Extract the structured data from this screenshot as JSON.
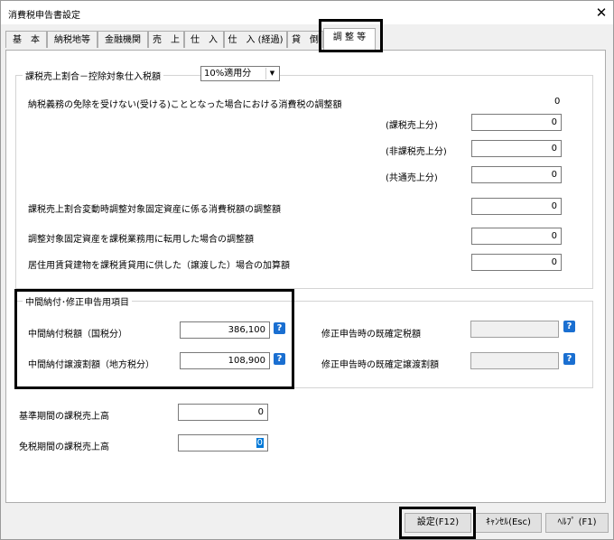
{
  "window": {
    "title": "消費税申告書設定",
    "close_glyph": "✕"
  },
  "tabs": [
    {
      "label": "基　本"
    },
    {
      "label": "納税地等"
    },
    {
      "label": "金融機関"
    },
    {
      "label": "売　上"
    },
    {
      "label": "仕　入"
    },
    {
      "label": "仕　入 (経過)"
    },
    {
      "label": "貸　倒"
    },
    {
      "label": "調 整 等"
    }
  ],
  "active_tab_index": 7,
  "adjust_group": {
    "legend": "課税売上割合－控除対象仕入税額",
    "rate_select": "10%適用分",
    "exempt_label": "納税義務の免除を受けない(受ける)こととなった場合における消費税の調整額",
    "exempt_value": "0",
    "sub_rows": [
      {
        "label": "(課税売上分)",
        "value": "0"
      },
      {
        "label": "(非課税売上分)",
        "value": "0"
      },
      {
        "label": "(共通売上分)",
        "value": "0"
      }
    ],
    "rows": [
      {
        "label": "課税売上割合変動時調整対象固定資産に係る消費税額の調整額",
        "value": "0"
      },
      {
        "label": "調整対象固定資産を課税業務用に転用した場合の調整額",
        "value": "0"
      },
      {
        "label": "居住用賃貸建物を課税賃貸用に供した（譲渡した）場合の加算額",
        "value": "0"
      }
    ]
  },
  "interim_group": {
    "legend": "中間納付･修正申告用項目",
    "interim_tax_label": "中間納付税額（国税分）",
    "interim_tax_value": "386,100",
    "interim_transfer_label": "中間納付譲渡割額（地方税分）",
    "interim_transfer_value": "108,900",
    "fixed_tax_label": "修正申告時の既確定税額",
    "fixed_tax_value": "",
    "fixed_transfer_label": "修正申告時の既確定譲渡割額",
    "fixed_transfer_value": "",
    "help_glyph": "?"
  },
  "base_period_label": "基準期間の課税売上高",
  "base_period_value": "0",
  "exempt_period_label": "免税期間の課税売上高",
  "exempt_period_value": "0",
  "buttons": {
    "ok": "設定(F12)",
    "cancel": "ｷｬﾝｾﾙ(Esc)",
    "help": "ﾍﾙﾌﾟ (F1)"
  }
}
